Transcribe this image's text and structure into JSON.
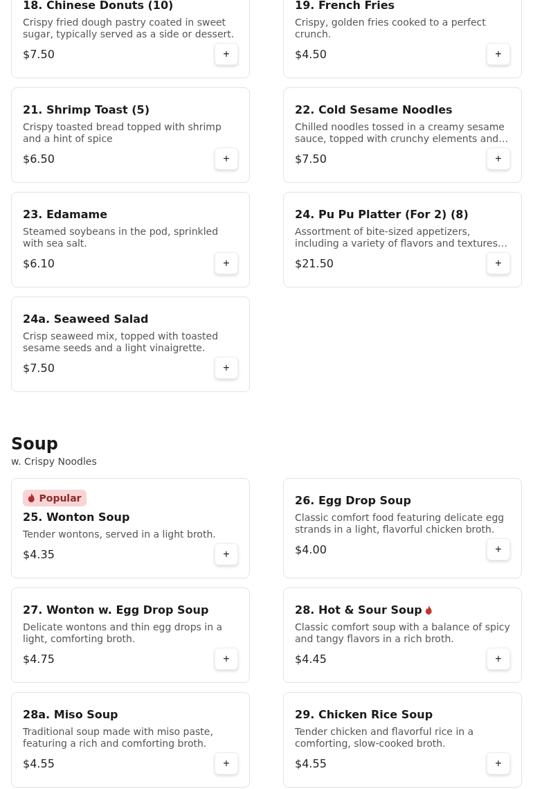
{
  "sections": [
    {
      "items": [
        {
          "name": "18. Chinese Donuts (10)",
          "description": "Crispy fried dough pastry coated in sweet sugar, typically served as a side or dessert.",
          "price": "$7.50",
          "spicy": false,
          "button": "+"
        },
        {
          "name": "19. French Fries",
          "description": "Crispy, golden fries cooked to a perfect crunch.",
          "price": "$4.50",
          "spicy": false,
          "button": "+"
        },
        {
          "name": "21. Shrimp Toast (5)",
          "description": "Crispy toasted bread topped with shrimp and a hint of spice",
          "price": "$6.50",
          "spicy": false,
          "button": "+"
        },
        {
          "name": "22. Cold Sesame Noodles",
          "description": "Chilled noodles tossed in a creamy sesame sauce, topped with crunchy elements and…",
          "price": "$7.50",
          "spicy": false,
          "button": "+"
        },
        {
          "name": "23. Edamame",
          "description": "Steamed soybeans in the pod, sprinkled with sea salt.",
          "price": "$6.10",
          "spicy": false,
          "button": "+"
        },
        {
          "name": "24. Pu Pu Platter (For 2) (8)",
          "description": "Assortment of bite-sized appetizers, including a variety of flavors and textures…",
          "price": "$21.50",
          "spicy": false,
          "button": "+"
        },
        {
          "name": "24a. Seaweed Salad",
          "description": "Crisp seaweed mix, topped with toasted sesame seeds and a light vinaigrette.",
          "price": "$7.50",
          "spicy": false,
          "button": "+"
        }
      ]
    },
    {
      "title": "Soup",
      "subtitle": "w. Crispy Noodles",
      "items": [
        {
          "name": "25. Wonton Soup",
          "description": "Tender wontons, served in a light broth.",
          "price": "$4.35",
          "spicy": false,
          "button": "+",
          "badge": {
            "label": "Popular"
          }
        },
        {
          "name": "26. Egg Drop Soup",
          "description": "Classic comfort food featuring delicate egg strands in a light, flavorful chicken broth.",
          "price": "$4.00",
          "spicy": false,
          "button": "+"
        },
        {
          "name": "27. Wonton w. Egg Drop Soup",
          "description": "Delicate wontons and thin egg drops in a light, comforting broth.",
          "price": "$4.75",
          "spicy": false,
          "button": "+"
        },
        {
          "name": "28. Hot & Sour Soup",
          "description": "Classic comfort soup with a balance of spicy and tangy flavors in a rich broth.",
          "price": "$4.45",
          "spicy": true,
          "button": "+"
        },
        {
          "name": "28a. Miso Soup",
          "description": "Traditional soup made with miso paste, featuring a rich and comforting broth.",
          "price": "$4.55",
          "spicy": false,
          "button": "+"
        },
        {
          "name": "29. Chicken Rice Soup",
          "description": "Tender chicken and flavorful rice in a comforting, slow-cooked broth.",
          "price": "$4.55",
          "spicy": false,
          "button": "+"
        }
      ]
    }
  ]
}
